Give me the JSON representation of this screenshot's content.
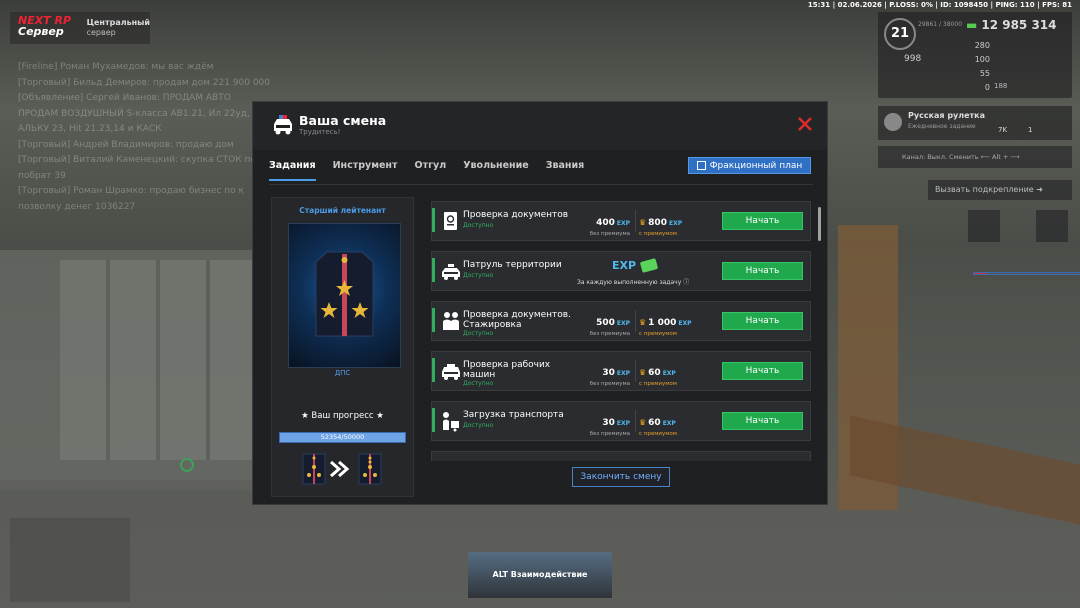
{
  "hud": {
    "server_logo_line1": "NEXT RP",
    "server_logo_line2": "Сервер",
    "server_name": "Центральный",
    "server_sub": "сервер",
    "status_line": "15:31 | 02.06.2026 | P.LOSS: 0% | ID: 1098450 | PING: 110 | FPS: 81",
    "level": "21",
    "xp_text": "29861 / 38000",
    "money": "12 985 314",
    "health": "280",
    "armor": "100",
    "hunger": "55",
    "stat4": "0",
    "p998": "998",
    "p188": "188",
    "roulette_title": "Русская рулетка",
    "roulette_sub": "Ежедневное задание",
    "roulette_a": "7K",
    "roulette_b": "1",
    "channel": "Канал: Выкл.      Сменить ⟵ Alt + ⟶",
    "backup": "Вызвать подкрепление ➜",
    "alt_action": "ALT Взаимодействие"
  },
  "chat": [
    "[Fireline] Роман Мухамедов: мы вас ждём",
    "[Торговый] Бильд Демиров: продам дом 221 900 000",
    "[Объявление] Сергей Иванов: ПРОДАМ АВТО",
    "ПРОДАМ ВОЗДУШНЫЙ S-класса АВ1.21, Ил 22уд, 1",
    "АЛЬКУ 23, Hit 21.23,14 и КАСК",
    "[Торговый] Андрей Владимиров: продаю дом",
    "[Торговый] Виталий Каменецкий: скупка СТОК по",
    "побрат 39",
    "[Торговый] Роман Шрамко: продаю бизнес по к",
    "позволку денег 1036227"
  ],
  "modal": {
    "title": "Ваша смена",
    "subtitle": "Трудитесь!",
    "tabs": [
      "Задания",
      "Инструмент",
      "Отгул",
      "Увольнение",
      "Звания"
    ],
    "faction_plan": "Фракционный план",
    "finish": "Закончить смену"
  },
  "rank": {
    "name": "Старший лейтенант",
    "unit": "ДПС",
    "progress_label": "★ Ваш прогресс ★",
    "progress_text": "52354/50000",
    "progress_fraction": 1.0
  },
  "tasks": [
    {
      "name": "Проверка документов",
      "status": "Доступно",
      "base": "400",
      "prem": "800",
      "base_label": "без премиума",
      "prem_label": "с премиумом",
      "button": "Начать",
      "icon": "passport-icon"
    },
    {
      "name": "Патруль территории",
      "status": "Доступно",
      "each": "За каждую выполненную задачу",
      "button": "Начать",
      "icon": "police-car-icon"
    },
    {
      "name": "Проверка документов. Стажировка",
      "status": "Доступно",
      "base": "500",
      "prem": "1 000",
      "base_label": "без премиума",
      "prem_label": "с премиумом",
      "button": "Начать",
      "icon": "officers-icon"
    },
    {
      "name": "Проверка рабочих машин",
      "status": "Доступно",
      "base": "30",
      "prem": "60",
      "base_label": "без премиума",
      "prem_label": "с премиумом",
      "button": "Начать",
      "icon": "truck-icon"
    },
    {
      "name": "Загрузка транспорта",
      "status": "Доступно",
      "base": "30",
      "prem": "60",
      "base_label": "без премиума",
      "prem_label": "с премиумом",
      "button": "Начать",
      "icon": "cargo-icon"
    }
  ],
  "exp_label": "EXP",
  "colors": {
    "accent": "#2f6fc4",
    "start": "#1fa84c",
    "exp": "#4fb8f0",
    "premium": "#e8a12b"
  }
}
